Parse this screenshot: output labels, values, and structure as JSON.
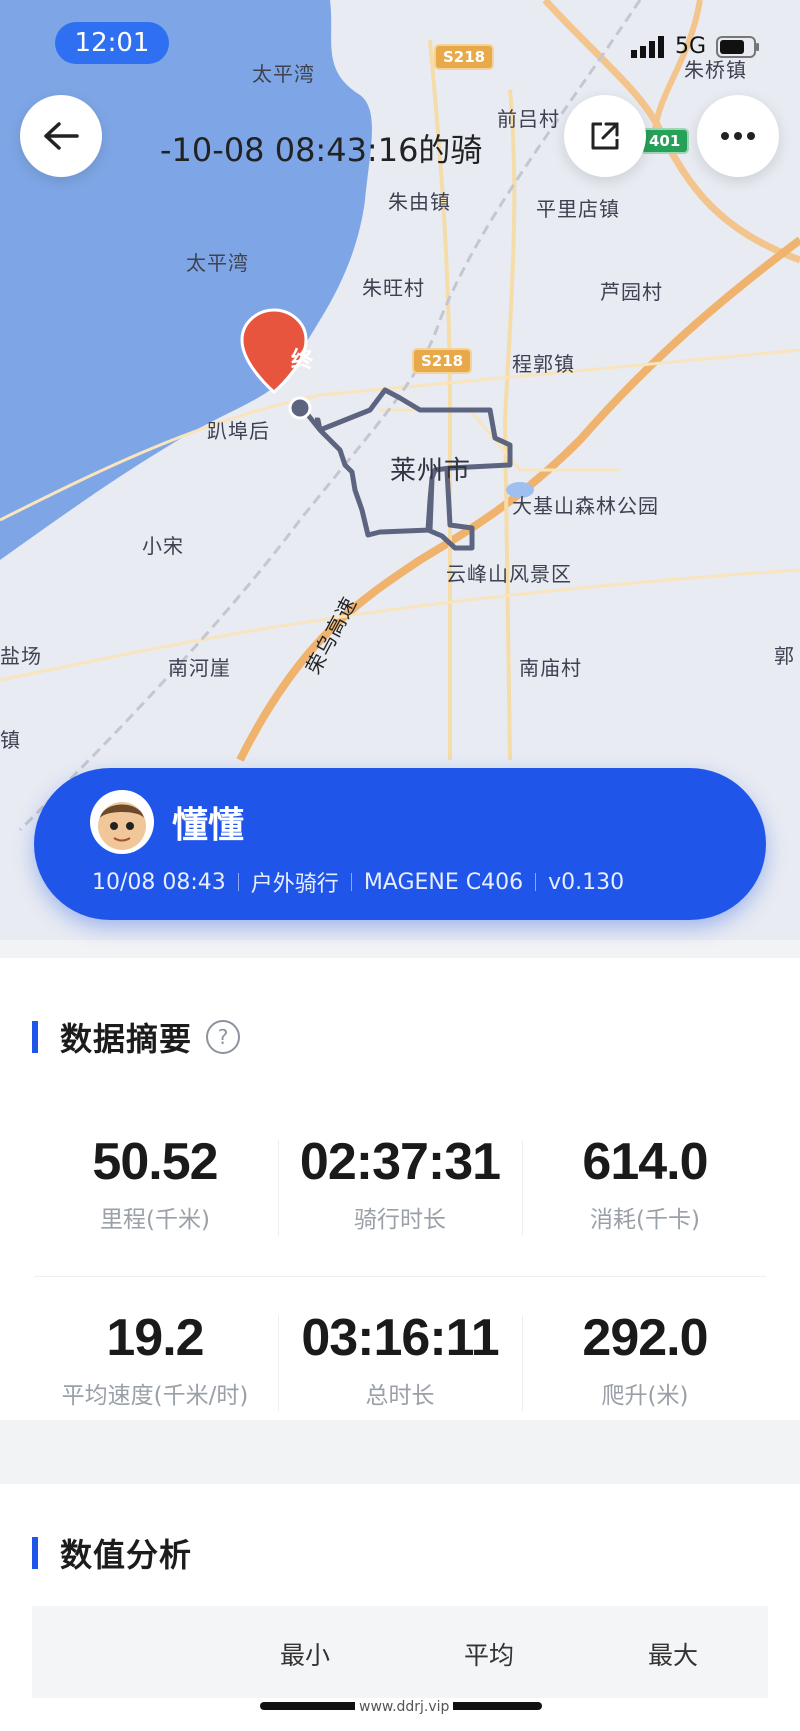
{
  "status": {
    "time": "12:01",
    "network": "5G"
  },
  "header": {
    "title": "-10-08 08:43:16的骑"
  },
  "map": {
    "places": [
      "太平湾",
      "前吕村",
      "朱桥镇",
      "朱由镇",
      "平里店镇",
      "太平湾",
      "朱旺村",
      "芦园村",
      "程郭镇",
      "趴埠后",
      "莱州市",
      "大基山森林公园",
      "小宋",
      "云峰山风景区",
      "盐场",
      "南河崖",
      "南庙村",
      "郭",
      "镇"
    ],
    "road_badges": [
      "S218",
      "S218",
      "401"
    ],
    "highway_label": "荣乌高速",
    "end_marker": "终"
  },
  "profile": {
    "name": "懂懂",
    "date": "10/08 08:43",
    "activity": "户外骑行",
    "device": "MAGENE C406",
    "version": "v0.130"
  },
  "summary": {
    "title": "数据摘要",
    "help": "?",
    "stats": [
      {
        "value": "50.52",
        "label": "里程(千米)"
      },
      {
        "value": "02:37:31",
        "label": "骑行时长"
      },
      {
        "value": "614.0",
        "label": "消耗(千卡)"
      },
      {
        "value": "19.2",
        "label": "平均速度(千米/时)"
      },
      {
        "value": "03:16:11",
        "label": "总时长"
      },
      {
        "value": "292.0",
        "label": "爬升(米)"
      }
    ]
  },
  "analysis": {
    "title": "数值分析",
    "columns": [
      "最小",
      "平均",
      "最大"
    ]
  },
  "watermark": "www.ddrj.vip",
  "colors": {
    "accent": "#1f55e9",
    "route": "#5d6480",
    "marker": "#e8553e"
  }
}
